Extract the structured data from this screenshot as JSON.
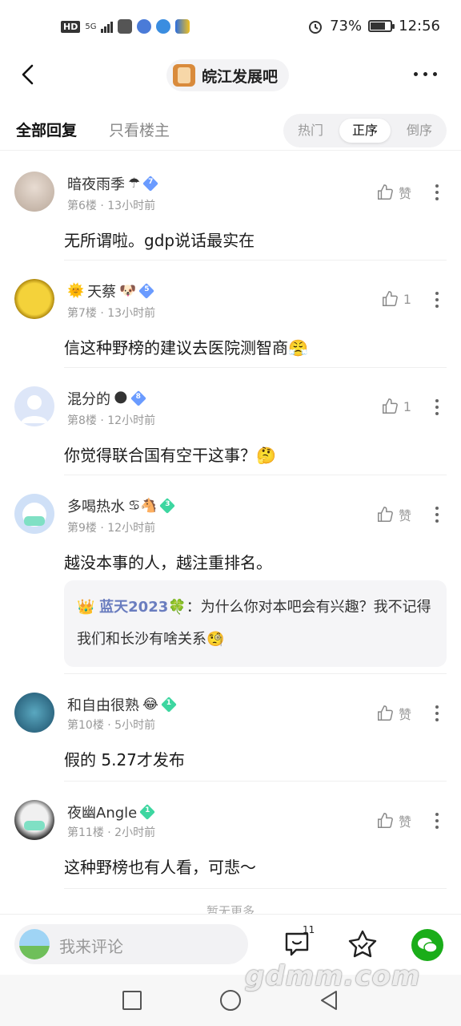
{
  "status_bar": {
    "hd": "HD",
    "network": "5G",
    "battery": "73%",
    "battery_level": 0.73,
    "time": "12:56"
  },
  "header": {
    "forum_name": "皖江发展吧"
  },
  "tabs": {
    "all_replies": "全部回复",
    "op_only": "只看楼主",
    "sort_options": [
      "热门",
      "正序",
      "倒序"
    ],
    "selected_sort": "正序"
  },
  "comments": [
    {
      "username": "暗夜雨季",
      "emoji": "☂",
      "level": "7",
      "floor_time": "第6楼 · 13小时前",
      "likes": "赞",
      "text": "无所谓啦。gdp说话最实在"
    },
    {
      "username": "天蔡",
      "emoji_before": "🌞",
      "emoji": "🐶",
      "level": "5",
      "floor_time": "第7楼 · 13小时前",
      "likes": "1",
      "text": "信这种野榜的建议去医院测智商😤"
    },
    {
      "username": "混分的",
      "emoji": "🌑",
      "level": "8",
      "floor_time": "第8楼 · 12小时前",
      "likes": "1",
      "text": "你觉得联合国有空干这事？🤔"
    },
    {
      "username": "多喝热水",
      "emoji": "♋🐴",
      "level": "3",
      "floor_time": "第9楼 · 12小时前",
      "likes": "赞",
      "text": "越没本事的人，越注重排名。",
      "quote": {
        "crown": "👑",
        "name": "蓝天2023",
        "clover": "🍀",
        "text": "：为什么你对本吧会有兴趣？我不记得我们和长沙有啥关系🧐"
      }
    },
    {
      "username": "和自由很熟",
      "emoji": "😂",
      "level": "1",
      "floor_time": "第10楼 · 5小时前",
      "likes": "赞",
      "text": "假的 5.27才发布"
    },
    {
      "username": "夜幽Angle",
      "emoji": "",
      "level": "1",
      "floor_time": "第11楼 · 2小时前",
      "likes": "赞",
      "text": "这种野榜也有人看，可悲～"
    }
  ],
  "no_more": "暂无更多",
  "bottom": {
    "placeholder": "我来评论",
    "comment_count": "11"
  },
  "watermark": "gdmm.com",
  "colors": {
    "level_blue": "#6a9bff",
    "level_green": "#3dd6a0",
    "wechat": "#1aad19",
    "quote_name": "#6a7dbf"
  }
}
